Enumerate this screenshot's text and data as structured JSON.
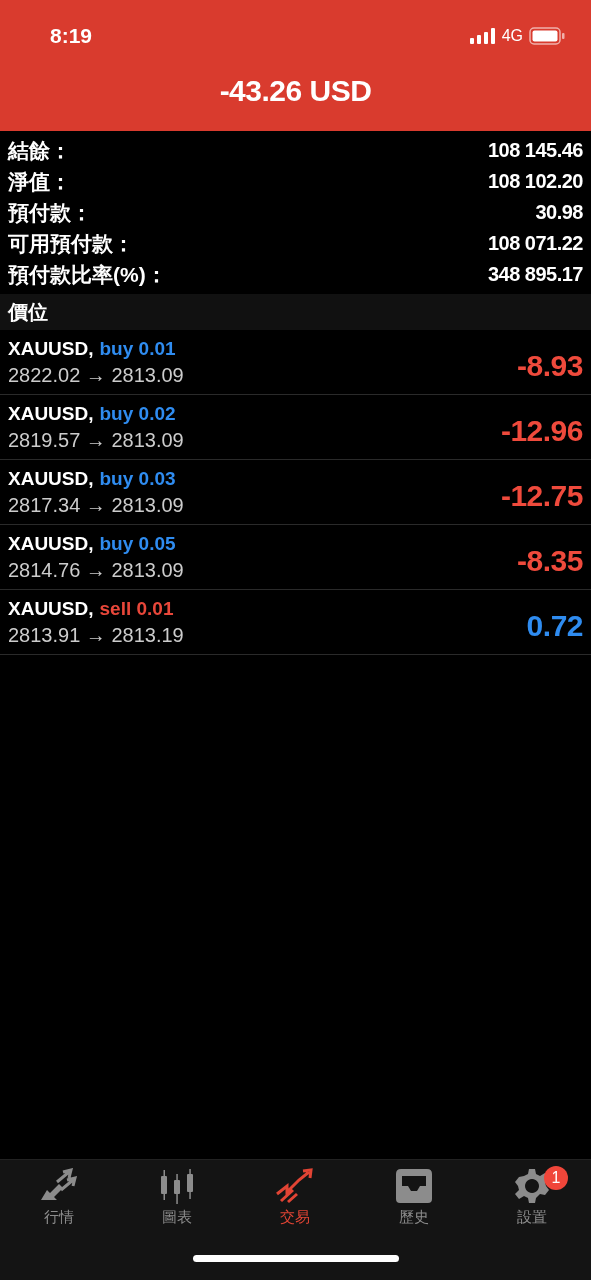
{
  "status_bar": {
    "time": "8:19",
    "network": "4G"
  },
  "header": {
    "title": "-43.26 USD"
  },
  "summary": [
    {
      "label": "結餘：",
      "value": "108 145.46"
    },
    {
      "label": "淨值：",
      "value": "108 102.20"
    },
    {
      "label": "預付款：",
      "value": "30.98"
    },
    {
      "label": "可用預付款：",
      "value": "108 071.22"
    },
    {
      "label": "預付款比率(%)：",
      "value": "348 895.17"
    }
  ],
  "section_title": "價位",
  "positions": [
    {
      "symbol": "XAUUSD,",
      "order": "buy 0.01",
      "kind": "buy",
      "prices": "2822.02 → 2813.09",
      "profit": {
        "text": "-8.93",
        "color": "#ef4a3c"
      }
    },
    {
      "symbol": "XAUUSD,",
      "order": "buy 0.02",
      "kind": "buy",
      "prices": "2819.57 → 2813.09",
      "profit": {
        "text": "-12.96",
        "color": "#ef4a3c"
      }
    },
    {
      "symbol": "XAUUSD,",
      "order": "buy 0.03",
      "kind": "buy",
      "prices": "2817.34 → 2813.09",
      "profit": {
        "text": "-12.75",
        "color": "#ef4a3c"
      }
    },
    {
      "symbol": "XAUUSD,",
      "order": "buy 0.05",
      "kind": "buy",
      "prices": "2814.76 → 2813.09",
      "profit": {
        "text": "-8.35",
        "color": "#ef4a3c"
      }
    },
    {
      "symbol": "XAUUSD,",
      "order": "sell 0.01",
      "kind": "sell",
      "prices": "2813.91 → 2813.19",
      "profit": {
        "text": "0.72",
        "color": "#2f8cf0"
      }
    }
  ],
  "tabs": [
    {
      "label": "行情",
      "kind": "quotes",
      "selected": false
    },
    {
      "label": "圖表",
      "kind": "chart",
      "selected": false
    },
    {
      "label": "交易",
      "kind": "trade",
      "selected": true
    },
    {
      "label": "歷史",
      "kind": "history",
      "selected": false
    },
    {
      "label": "設置",
      "kind": "settings",
      "selected": false,
      "badge": "1"
    }
  ]
}
